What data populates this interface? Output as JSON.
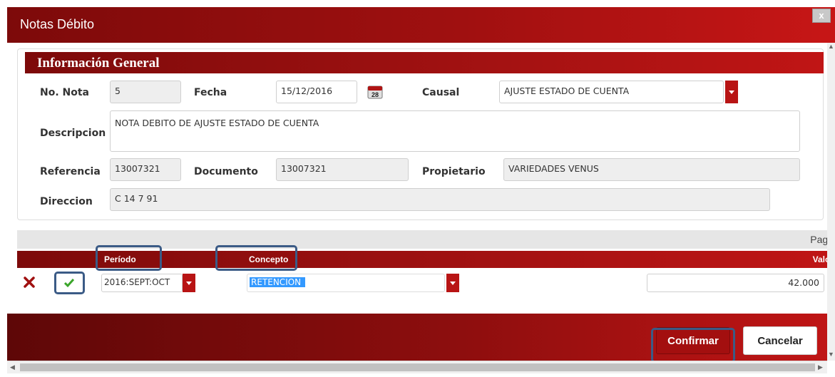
{
  "window": {
    "title": "Notas Débito",
    "close_label": "x"
  },
  "panel": {
    "title": "Información General"
  },
  "form": {
    "no_nota_label": "No. Nota",
    "no_nota_value": "5",
    "fecha_label": "Fecha",
    "fecha_value": "15/12/2016",
    "causal_label": "Causal",
    "causal_value": "AJUSTE ESTADO DE CUENTA",
    "descripcion_label": "Descripcion",
    "descripcion_value": "NOTA DEBITO DE AJUSTE ESTADO DE CUENTA",
    "referencia_label": "Referencia",
    "referencia_value": "13007321",
    "documento_label": "Documento",
    "documento_value": "13007321",
    "propietario_label": "Propietario",
    "propietario_value": "VARIEDADES VENUS",
    "direccion_label": "Direccion",
    "direccion_value": "C 14 7 91"
  },
  "grid": {
    "pager_text": "Page",
    "columns": {
      "periodo": "Período",
      "concepto": "Concepto",
      "valor": "Valor"
    },
    "row": {
      "periodo": "2016:SEPT:OCT",
      "concepto": "RETENCION",
      "valor": "42.000"
    }
  },
  "footer": {
    "confirm_label": "Confirmar",
    "cancel_label": "Cancelar"
  },
  "colors": {
    "brand": "#a30f0f",
    "highlight": "#3b5b86",
    "check": "#3aa52a",
    "delete": "#a01010"
  },
  "icons": {
    "calendar": "calendar-icon",
    "delete": "delete-row-icon",
    "confirm_row": "check-icon",
    "dropdown": "chevron-down-icon"
  }
}
